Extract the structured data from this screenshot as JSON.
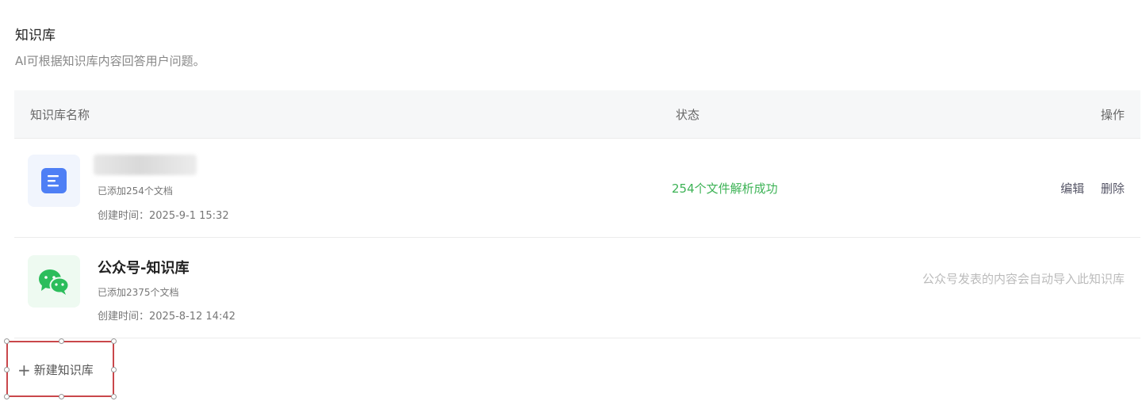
{
  "section": {
    "title": "知识库",
    "description": "AI可根据知识库内容回答用户问题。"
  },
  "table": {
    "headers": {
      "name": "知识库名称",
      "status": "状态",
      "action": "操作"
    },
    "rows": [
      {
        "icon": "document-icon",
        "name": "",
        "count": "已添加254个文档",
        "created": "创建时间：2025-9-1 15:32",
        "status": "254个文件解析成功",
        "actions": {
          "edit": "编辑",
          "delete": "删除"
        }
      },
      {
        "icon": "wechat-icon",
        "name": "公众号-知识库",
        "count": "已添加2375个文档",
        "created": "创建时间：2025-8-12 14:42",
        "note": "公众号发表的内容会自动导入此知识库"
      }
    ]
  },
  "new_kb": {
    "plus": "+",
    "label": "新建知识库"
  },
  "colors": {
    "status_success": "#3db356",
    "selection_border": "#c9474b",
    "doc_icon": "#4e7ff5",
    "wechat_icon": "#2bbd5b"
  }
}
